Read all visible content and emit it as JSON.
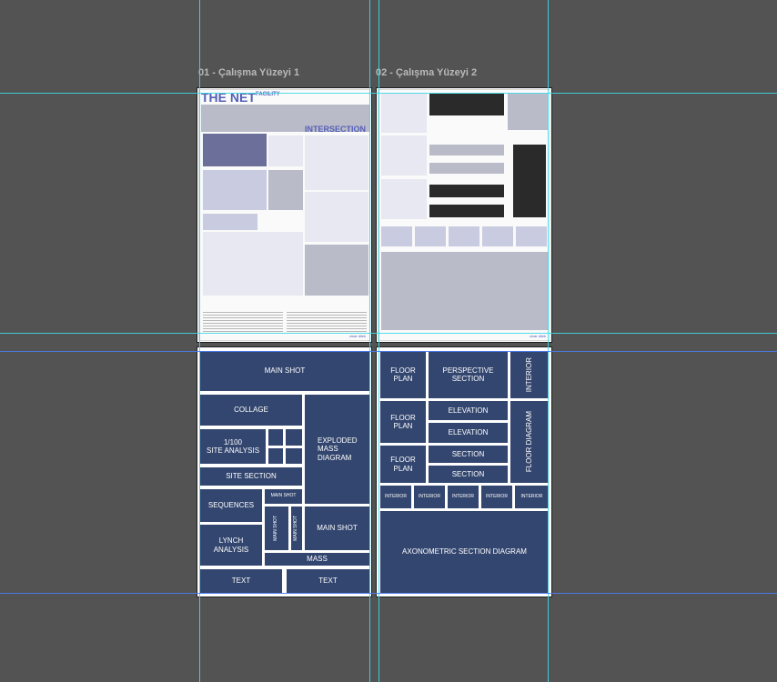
{
  "artboards": [
    {
      "label": "01 - Çalışma Yüzeyi 1"
    },
    {
      "label": "02 - Çalışma Yüzeyi 2"
    }
  ],
  "poster1": {
    "title": "THE NET",
    "title_small": "FACILITY",
    "heading": "INTERSECTION",
    "footer": "cinar dilek"
  },
  "poster2": {
    "footer": "cinar dilek"
  },
  "layout1": {
    "main_shot": "MAIN SHOT",
    "collage": "COLLAGE",
    "site_analysis": "1/100\nSITE ANALYSIS",
    "exploded": "EXPLODED\nMASS\nDIAGRAM",
    "site_section": "SITE SECTION",
    "sequences": "SEQUENCES",
    "main_shot_small": "MAIN SHOT",
    "main_shot_v1": "MAIN SHOT",
    "main_shot_v2": "MAIN SHOT",
    "main_shot_2": "MAIN SHOT",
    "lynch": "LYNCH\nANALYSIS",
    "mass": "MASS",
    "text1": "TEXT",
    "text2": "TEXT"
  },
  "layout2": {
    "floor_plan_1": "FLOOR\nPLAN",
    "perspective_section": "PERSPECTIVE\nSECTION",
    "interior_v": "INTERIOR",
    "floor_plan_2": "FLOOR\nPLAN",
    "elevation_1": "ELEVATION",
    "elevation_2": "ELEVATION",
    "floor_diagram": "FLOOR DIAGRAM",
    "floor_plan_3": "FLOOR\nPLAN",
    "section_1": "SECTION",
    "section_2": "SECTION",
    "interiors": [
      "INTERIOR",
      "INTERIOR",
      "INTERIOR",
      "INTERIOR",
      "INTERIOR"
    ],
    "axonometric": "AXONOMETRIC SECTION DIAGRAM"
  },
  "colors": {
    "canvas": "#535353",
    "block": "#33466f",
    "guide": "#3fd8e6",
    "accent": "#5560b8"
  }
}
